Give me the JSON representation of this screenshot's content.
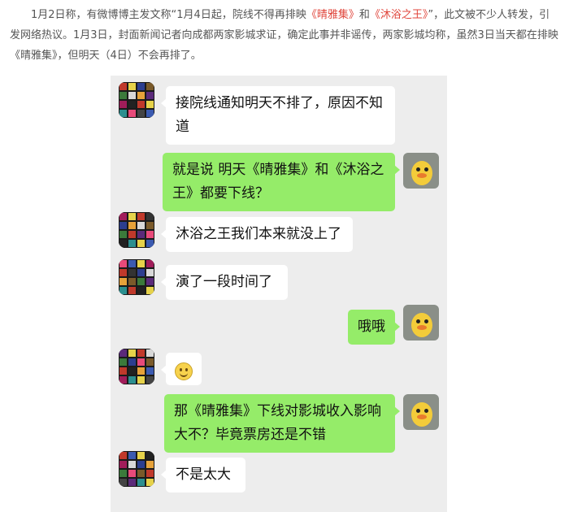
{
  "article": {
    "text_part1": "1月2日称，有微博博主发文称“1月4日起，院线不得再排映",
    "movie1": "《晴雅集》",
    "and": "和",
    "movie2": "《沐浴之王》",
    "text_part2": "”，此文被不少人转发，引发网络热议。1月3日，封面新闻记者向成都两家影城求证，确定此事并非谣传，两家影城均称，虽然3日当天都在排映《晴雅集》，但明天（4日）不会再排了。"
  },
  "chat": {
    "messages": [
      {
        "side": "left",
        "text": "接院线通知明天不排了，原因不知道"
      },
      {
        "side": "right",
        "text": "就是说 明天《晴雅集》和《沐浴之王》都要下线？"
      },
      {
        "side": "left",
        "text": "沐浴之王我们本来就没上了"
      },
      {
        "side": "left",
        "text": "演了一段时间了"
      },
      {
        "side": "right",
        "text": "哦哦"
      },
      {
        "side": "left",
        "emoji": "smile-emoji"
      },
      {
        "side": "right",
        "text": "那《晴雅集》下线对影城收入影响大不？毕竟票房还是不错"
      },
      {
        "side": "left",
        "text": "不是太大"
      }
    ]
  },
  "colors": {
    "chat_background": "#ededed",
    "bubble_sent": "#95ec69",
    "bubble_received": "#ffffff",
    "highlight": "#e0453b"
  }
}
